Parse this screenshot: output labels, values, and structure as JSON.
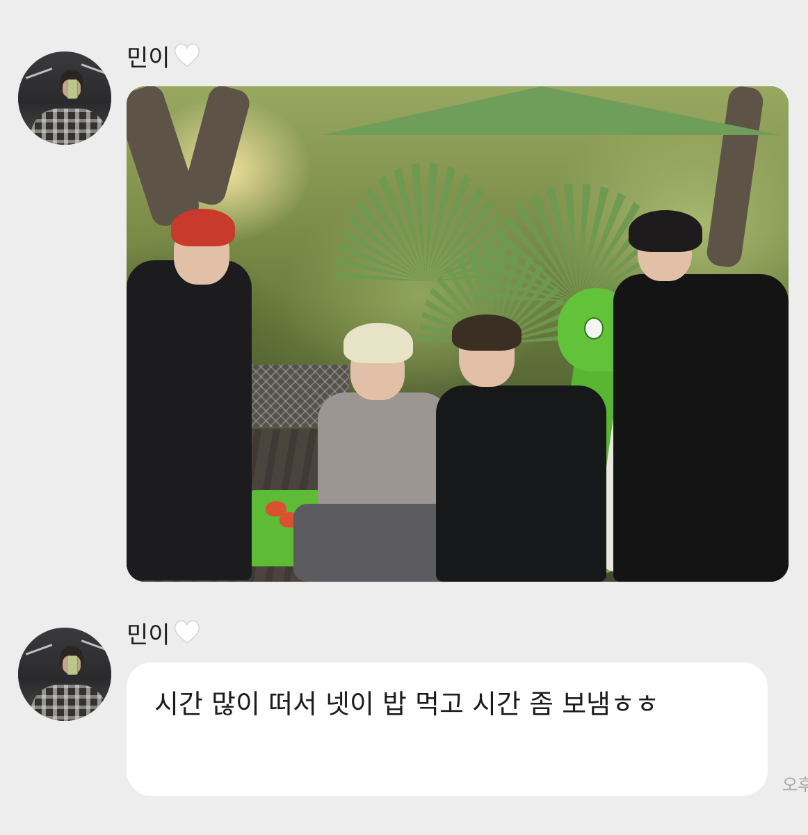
{
  "messages": [
    {
      "sender": "민이",
      "heart_icon": "white-heart-icon",
      "type": "photo",
      "photo_icon": "group-photo"
    },
    {
      "sender": "민이",
      "heart_icon": "white-heart-icon",
      "type": "text",
      "text": "시간 많이 떠서 넷이 밥 먹고 시간 좀 보냄ㅎㅎ",
      "timestamp": "오후"
    }
  ],
  "colors": {
    "background": "#ededed",
    "bubble": "#ffffff",
    "timestamp": "#a9a9a9"
  }
}
